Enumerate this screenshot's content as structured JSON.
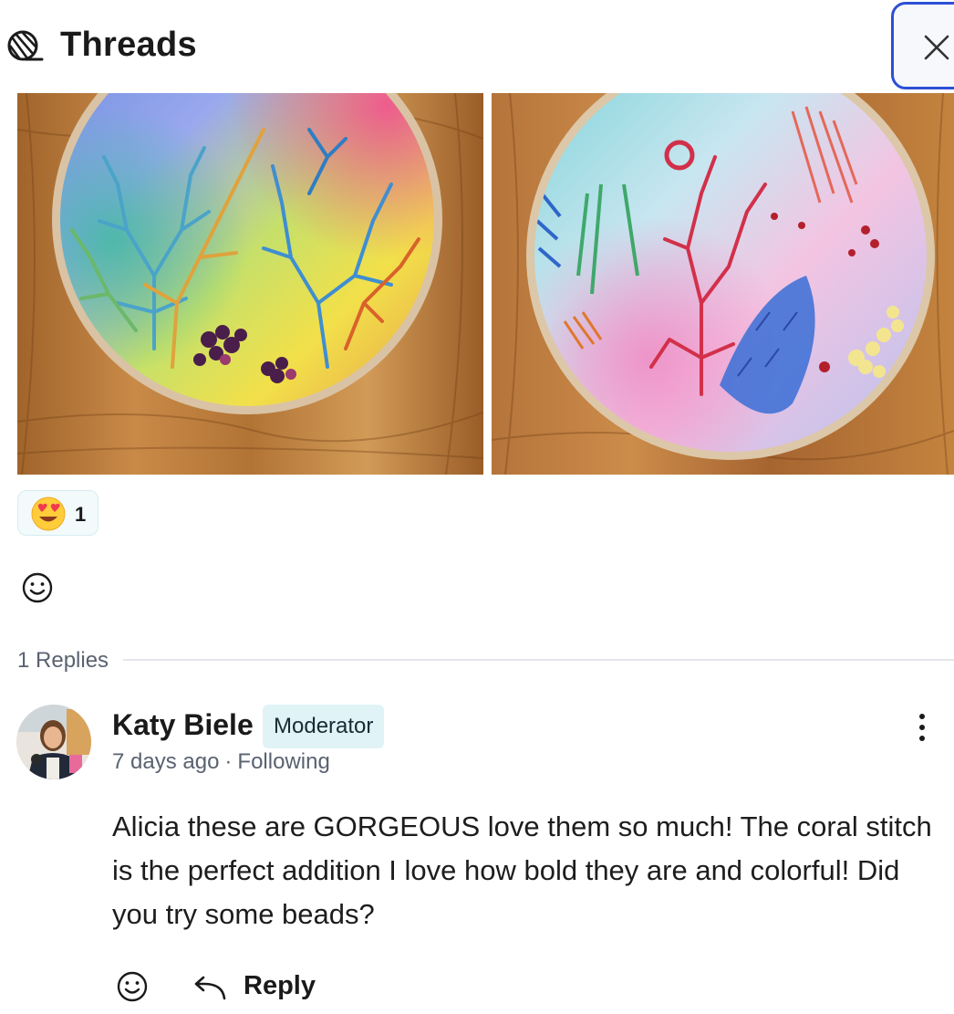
{
  "header": {
    "title": "Threads",
    "icon": "yarn-ball-icon",
    "close_icon": "close-icon"
  },
  "post": {
    "images": [
      {
        "name": "embroidery-hoop-coral-stitch-photo"
      },
      {
        "name": "embroidery-hoop-mixed-stitches-photo"
      }
    ],
    "reactions": [
      {
        "emoji": "heart-eyes-emoji",
        "count": "1"
      }
    ],
    "add_reaction_icon": "smiley-add-reaction-icon"
  },
  "replies": {
    "label": "1 Replies"
  },
  "comment": {
    "author": "Katy Biele",
    "role": "Moderator",
    "time": "7 days ago",
    "separator": "·",
    "follow_status": "Following",
    "body": "Alicia these are GORGEOUS love them so much! The coral stitch is the perfect addition I love how bold they are and colorful! Did you try some beads?",
    "reply_label": "Reply",
    "more_icon": "more-vertical-icon",
    "reply_icon": "reply-arrow-icon"
  },
  "colors": {
    "accent_focus": "#2d4fd6",
    "badge_bg": "#e0f4f8",
    "reaction_bg": "#f2fafc",
    "muted_text": "#5a6270"
  }
}
